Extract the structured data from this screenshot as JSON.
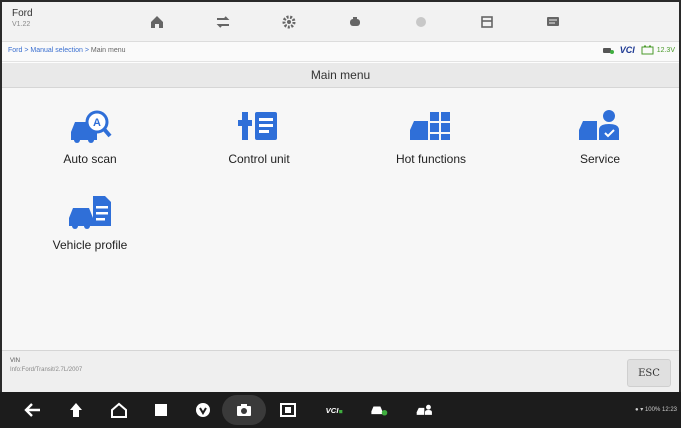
{
  "toolbar": {
    "make": "Ford",
    "version": "V1.22",
    "buttons": [
      {
        "name": "home-icon"
      },
      {
        "name": "vehicle-swap-icon"
      },
      {
        "name": "settings-gear-icon"
      },
      {
        "name": "vci-icon"
      },
      {
        "name": "browser-icon"
      },
      {
        "name": "print-icon"
      },
      {
        "name": "messages-icon"
      }
    ]
  },
  "breadcrumb": {
    "path": "Ford > Manual selection > ",
    "current": "Main menu"
  },
  "status": {
    "vci_label": "VCI",
    "voltage": "12.3V"
  },
  "page": {
    "title": "Main menu"
  },
  "menu": {
    "items": [
      {
        "label": "Auto scan",
        "icon": "auto-scan-icon"
      },
      {
        "label": "Control unit",
        "icon": "control-unit-icon"
      },
      {
        "label": "Hot functions",
        "icon": "hot-functions-icon"
      },
      {
        "label": "Service",
        "icon": "service-icon"
      },
      {
        "label": "Vehicle profile",
        "icon": "vehicle-profile-icon"
      }
    ]
  },
  "footer": {
    "vin_label": "VIN",
    "info": "Info:Ford/Transit/2.7L/2007",
    "esc_label": "ESC"
  },
  "navbar": {
    "system_status": "100% 12:23"
  },
  "colors": {
    "accent_blue": "#2f6fd8",
    "link_blue": "#3a6fd0",
    "nav_bg": "#1c1c1c"
  }
}
